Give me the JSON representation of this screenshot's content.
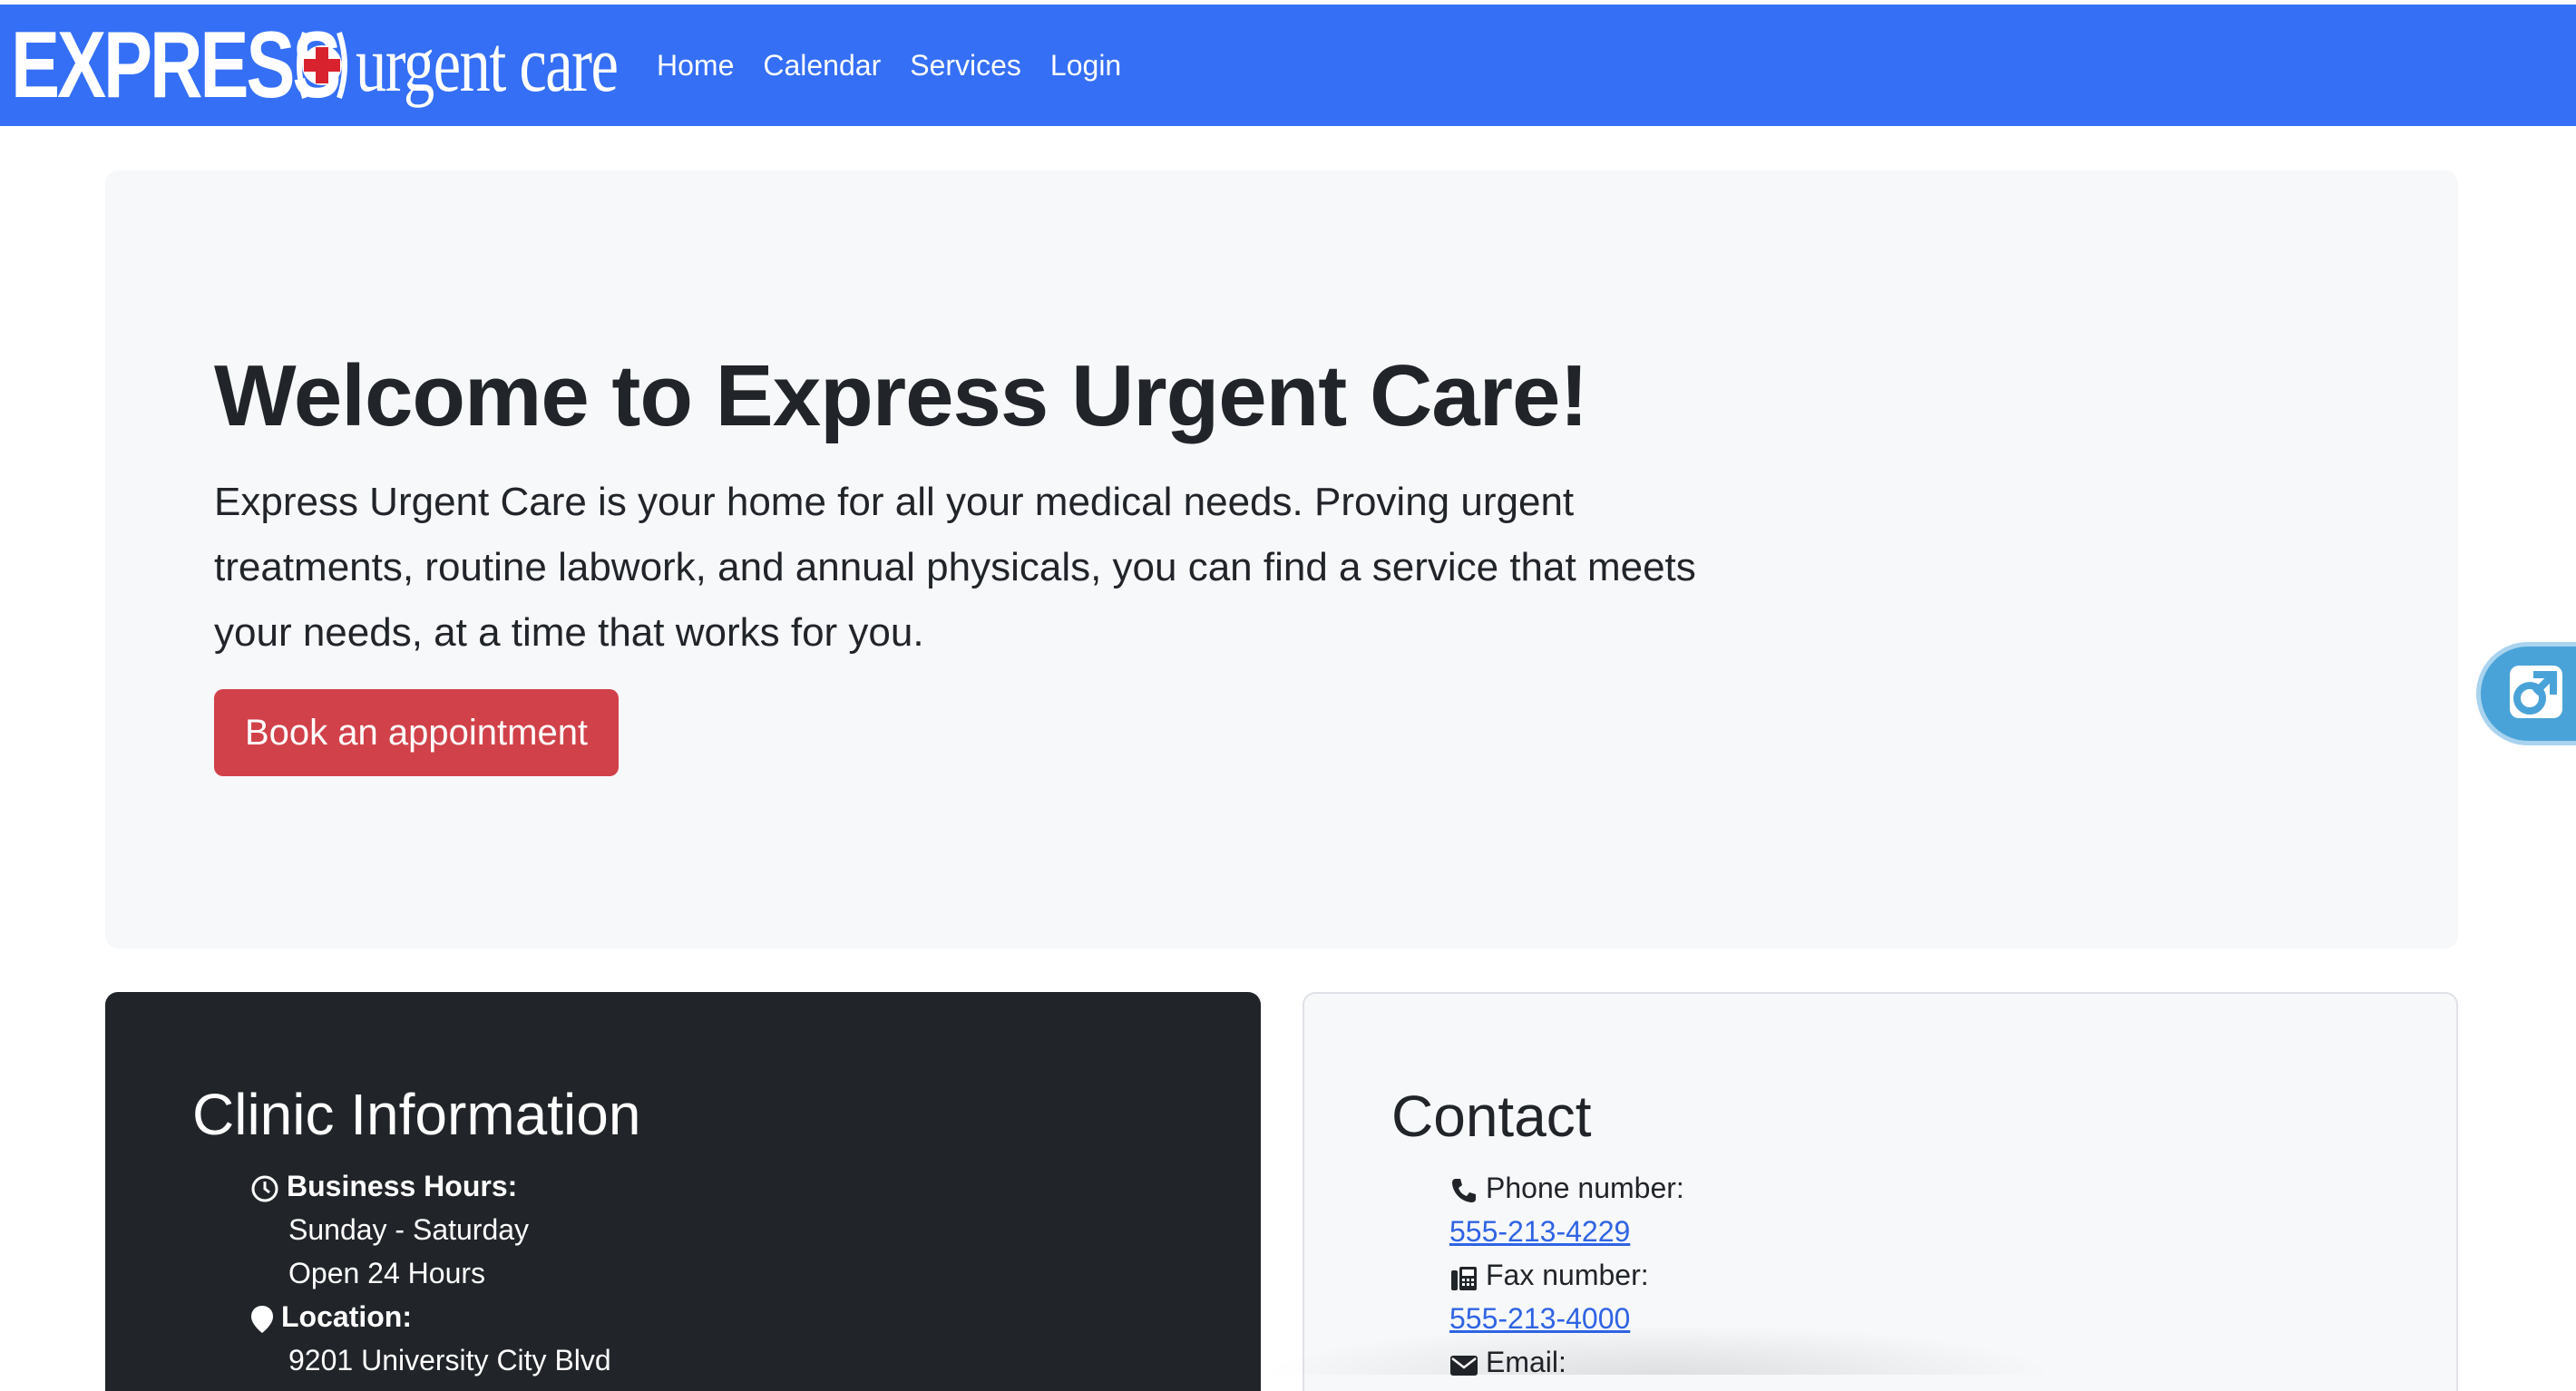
{
  "brand": {
    "express": "EXPRESS",
    "urgent_care": "urgent care",
    "colors": {
      "cross": "#d8232f",
      "text": "#ffffff"
    }
  },
  "nav": {
    "items": [
      {
        "label": "Home"
      },
      {
        "label": "Calendar"
      },
      {
        "label": "Services"
      },
      {
        "label": "Login"
      }
    ],
    "background": "#356ff5"
  },
  "hero": {
    "title": "Welcome to Express Urgent Care!",
    "text": "Express Urgent Care is your home for all your medical needs. Proving urgent treatments, routine labwork, and annual physicals, you can find a service that meets your needs, at a time that works for you.",
    "button_label": "Book an appointment",
    "button_color": "#d14149"
  },
  "widget": {
    "icon": "accessibility-arrow-icon"
  },
  "clinic": {
    "title": "Clinic Information",
    "hours_label": "Business Hours:",
    "hours_days": "Sunday - Saturday",
    "hours_time": "Open 24 Hours",
    "location_label": "Location:",
    "location_address": "9201 University City Blvd"
  },
  "contact": {
    "title": "Contact",
    "phone_label": "Phone number:",
    "phone_value": "555-213-4229",
    "fax_label": "Fax number:",
    "fax_value": "555-213-4000",
    "email_label": "Email:"
  }
}
